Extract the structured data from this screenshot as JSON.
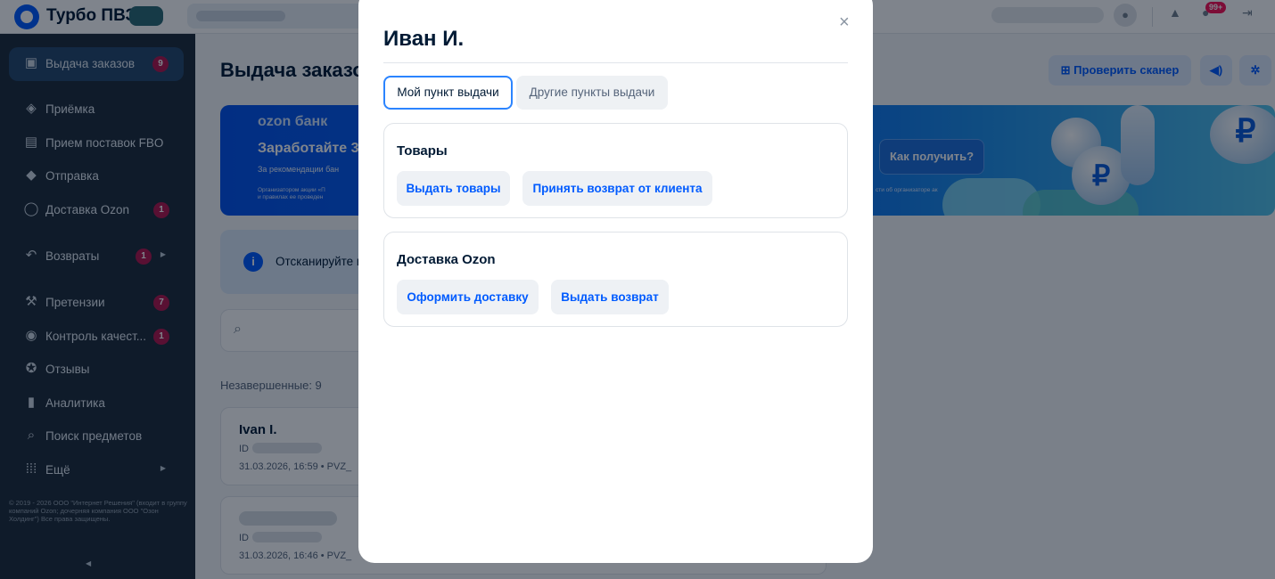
{
  "topbar": {
    "app_title": "Турбо ПВЗ",
    "notifications_badge": "99+"
  },
  "sidebar": {
    "items": [
      {
        "label": "Выдача заказов",
        "badge": "9",
        "icon": "box-hand-icon"
      },
      {
        "label": "Приёмка",
        "badge": "",
        "icon": "package-icon"
      },
      {
        "label": "Прием поставок FBO",
        "badge": "",
        "icon": "truck-icon"
      },
      {
        "label": "Отправка",
        "badge": "",
        "icon": "send-box-icon"
      },
      {
        "label": "Доставка Ozon",
        "badge": "1",
        "icon": "person-icon"
      },
      {
        "label": "Возвраты",
        "badge": "1",
        "icon": "return-arrow-icon"
      },
      {
        "label": "Претензии",
        "badge": "7",
        "icon": "gavel-icon"
      },
      {
        "label": "Контроль качест...",
        "badge": "1",
        "icon": "eye-icon"
      },
      {
        "label": "Отзывы",
        "badge": "",
        "icon": "star-chat-icon"
      },
      {
        "label": "Аналитика",
        "badge": "",
        "icon": "chart-icon"
      },
      {
        "label": "Поиск предметов",
        "badge": "",
        "icon": "search-icon"
      },
      {
        "label": "Ещё",
        "badge": "",
        "icon": "dots-grid-icon"
      }
    ],
    "footer": "© 2019 - 2026 ООО \"Интернет Решения\" (входит в группу компаний Ozon; дочерняя компания ООО \"Озон Холдинг\") Все права защищены."
  },
  "page": {
    "title": "Выдача заказов",
    "check_scanner": "Проверить сканер",
    "banner": {
      "brand": "ozon банк",
      "headline": "Заработайте 3",
      "sub": "За рекомендации бан",
      "fine_print_1": "Организатором акции «П",
      "fine_print_2": "и правилах ее проведен",
      "fine_print_right": "сти об организаторе ак",
      "cta": "Как получить?"
    },
    "info_text": "Отсканируйте и",
    "pending_label": "Незавершенные: 9",
    "orders": [
      {
        "name": "Ivan I.",
        "id_label": "ID",
        "meta": "31.03.2026, 16:59  •  PVZ_"
      },
      {
        "name": "",
        "id_label": "ID",
        "meta": "31.03.2026, 16:46  •  PVZ_"
      }
    ]
  },
  "modal": {
    "title": "Иван И.",
    "close_icon": "×",
    "tabs": [
      {
        "label": "Мой пункт выдачи",
        "active": true
      },
      {
        "label": "Другие пункты выдачи",
        "active": false
      }
    ],
    "sections": [
      {
        "title": "Товары",
        "actions": [
          "Выдать товары",
          "Принять возврат от клиента"
        ]
      },
      {
        "title": "Доставка Ozon",
        "actions": [
          "Оформить доставку",
          "Выдать возврат"
        ]
      }
    ]
  },
  "colors": {
    "accent": "#005bff",
    "sidebar_bg": "#1f2d3b",
    "badge": "#b3174d"
  }
}
